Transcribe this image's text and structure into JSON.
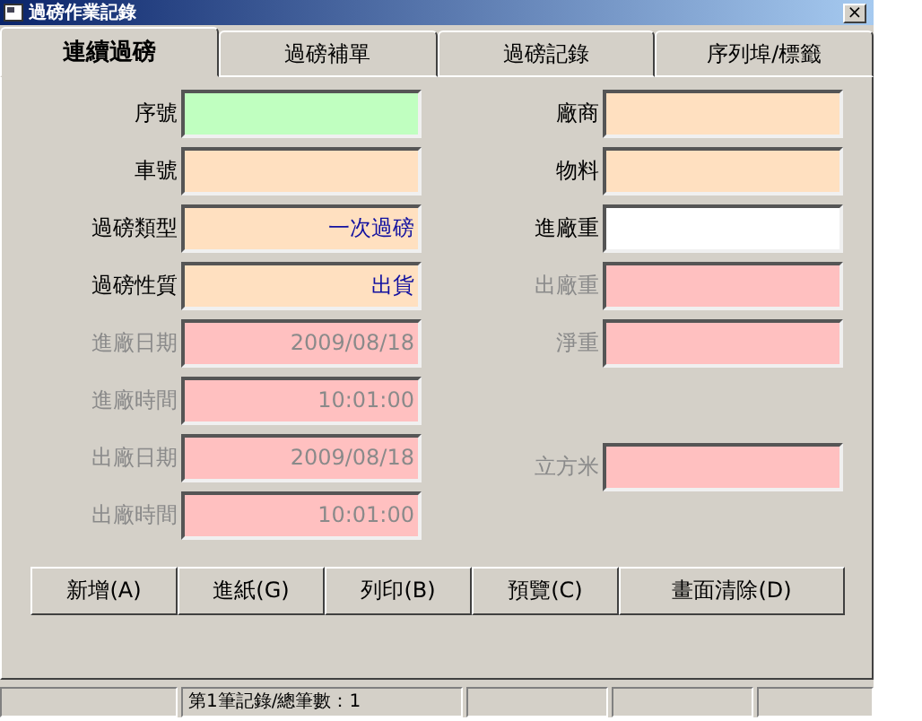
{
  "window": {
    "title": "過磅作業記錄",
    "close": "×"
  },
  "tabs": [
    {
      "label": "連續過磅",
      "selected": true
    },
    {
      "label": "過磅補單",
      "selected": false
    },
    {
      "label": "過磅記錄",
      "selected": false
    },
    {
      "label": "序列埠/標籤",
      "selected": false
    }
  ],
  "left_fields": [
    {
      "label": "序號",
      "color": "#c0ffc0",
      "disabled": false
    },
    {
      "label": "車號",
      "color": "#ffe0c0",
      "disabled": false
    },
    {
      "label": "過磅類型",
      "value": "一次過磅",
      "color": "#ffe0c0",
      "disabled": false
    },
    {
      "label": "過磅性質",
      "value": "出貨",
      "color": "#ffe0c0",
      "disabled": false
    },
    {
      "label": "進廠日期",
      "value": "2009/08/18",
      "color": "#ffc0c0",
      "disabled": true
    },
    {
      "label": "進廠時間",
      "value": "10:01:00",
      "color": "#ffc0c0",
      "disabled": true
    },
    {
      "label": "出廠日期",
      "value": "2009/08/18",
      "color": "#ffc0c0",
      "disabled": true
    },
    {
      "label": "出廠時間",
      "value": "10:01:00",
      "color": "#ffc0c0",
      "disabled": true
    }
  ],
  "right_fields": [
    {
      "label": "廠商",
      "color": "#ffe0c0",
      "disabled": false
    },
    {
      "label": "物料",
      "color": "#ffe0c0",
      "disabled": false
    },
    {
      "label": "進廠重",
      "color": "#ffffff",
      "disabled": false
    },
    {
      "label": "出廠重",
      "color": "#ffc0c0",
      "disabled": true
    },
    {
      "label": "淨重",
      "color": "#ffc0c0",
      "disabled": true
    },
    {
      "label": "立方米",
      "color": "#ffc0c0",
      "disabled": true
    }
  ],
  "buttons": [
    "新增(A)",
    "進紙(G)",
    "列印(B)",
    "預覽(C)",
    "畫面清除(D)"
  ],
  "status_bar": {
    "record": "第1筆記錄/總筆數：1"
  }
}
